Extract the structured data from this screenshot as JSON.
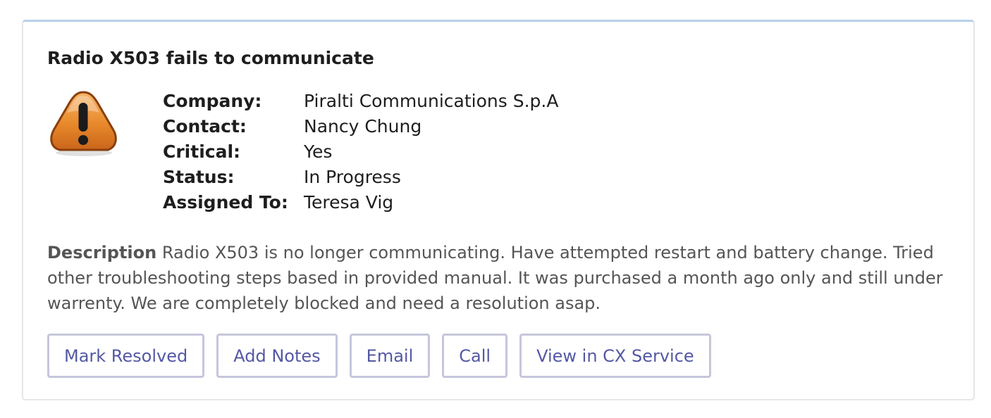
{
  "incident": {
    "title": "Radio X503 fails to communicate",
    "icon": "warning-exclamation-icon",
    "fields": [
      {
        "label": "Company:",
        "value": "Piralti Communications S.p.A"
      },
      {
        "label": "Contact:",
        "value": "Nancy Chung"
      },
      {
        "label": "Critical:",
        "value": "Yes"
      },
      {
        "label": "Status:",
        "value": "In Progress"
      },
      {
        "label": "Assigned To:",
        "value": "Teresa Vig"
      }
    ],
    "description_label": "Description",
    "description_text": "Radio X503 is no longer communicating. Have attempted restart and battery change. Tried other troubleshooting steps based in provided manual. It was purchased a month ago only and still under warrenty. We are completely blocked and need a resolution asap."
  },
  "actions": {
    "mark_resolved": "Mark Resolved",
    "add_notes": "Add Notes",
    "email": "Email",
    "call": "Call",
    "view_in_cx": "View in CX Service"
  },
  "colors": {
    "accent_border": "#b7d1ea",
    "button_text": "#5458a3",
    "button_border": "#c6c6dc",
    "icon_orange": "#e8892b"
  }
}
